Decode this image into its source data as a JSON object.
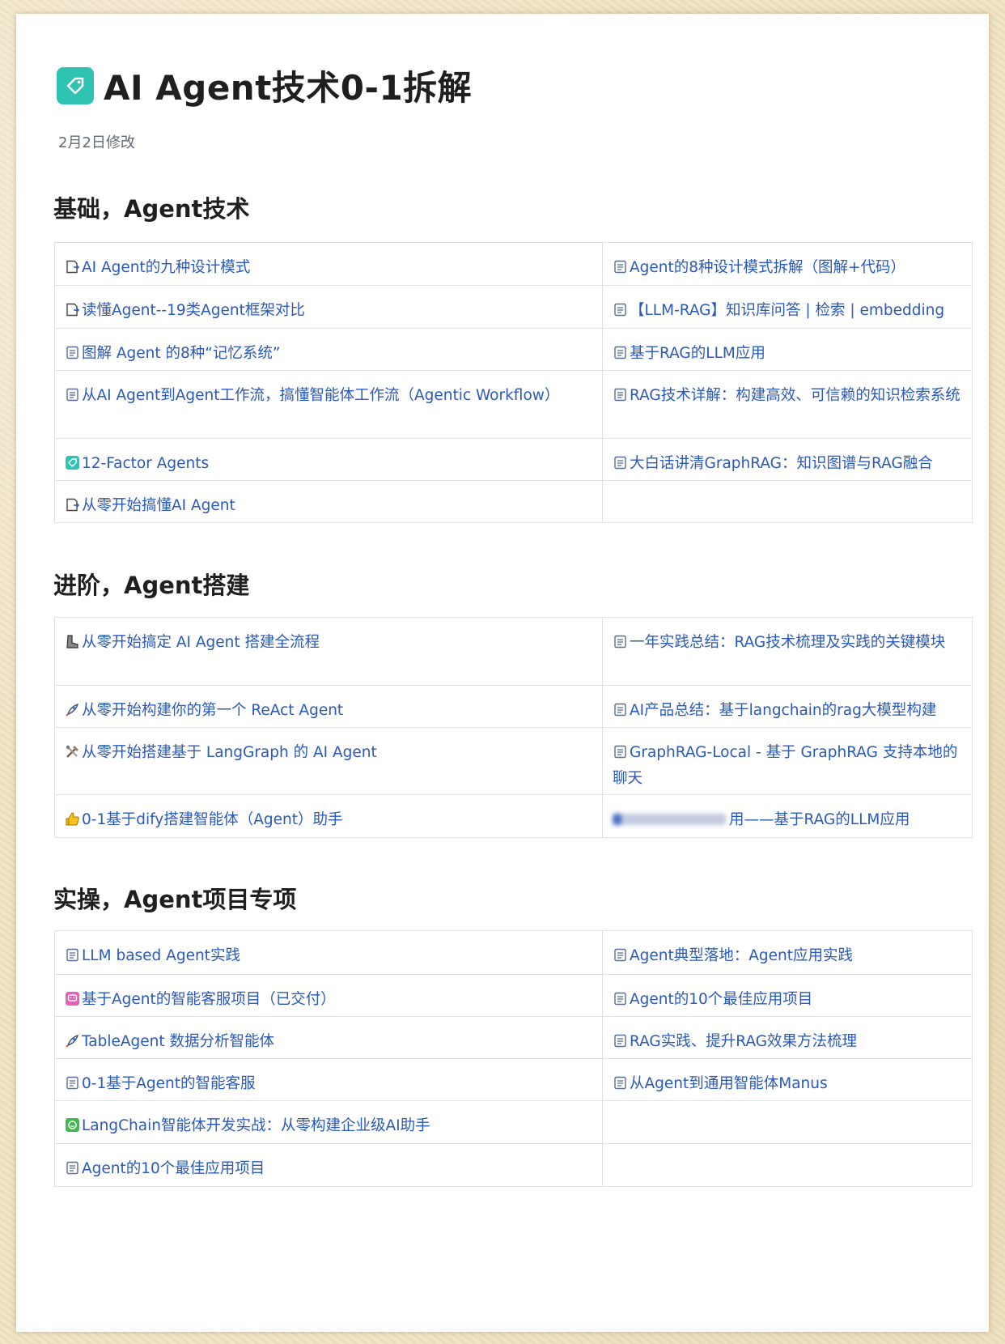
{
  "page": {
    "title": "AI Agent技术0-1拆解",
    "modified": "2月2日修改",
    "title_icon": "tag-icon",
    "colors": {
      "link": "#2a59bd",
      "title_icon_bg": "#2fc3b4",
      "background": "#efe3c4"
    }
  },
  "sections": [
    {
      "heading": "基础，Agent技术",
      "rows": [
        [
          {
            "icon": "doc-arrow-icon",
            "text": "AI Agent的九种设计模式"
          },
          {
            "icon": "doc-icon",
            "text": "Agent的8种设计模式拆解（图解+代码）"
          }
        ],
        [
          {
            "icon": "doc-arrow-icon",
            "text": "读懂Agent--19类Agent框架对比"
          },
          {
            "icon": "doc-icon",
            "text": "【LLM-RAG】知识库问答 | 检索 | embedding"
          }
        ],
        [
          {
            "icon": "doc-icon",
            "text": "图解 Agent 的8种“记忆系统”"
          },
          {
            "icon": "doc-icon",
            "text": "基于RAG的LLM应用"
          }
        ],
        [
          {
            "icon": "doc-icon",
            "text": "从AI Agent到Agent工作流，搞懂智能体工作流（Agentic Workflow）"
          },
          {
            "icon": "doc-icon",
            "text": "RAG技术详解：构建高效、可信赖的知识检索系统"
          }
        ],
        [
          {
            "icon": "teal-tag-icon",
            "text": "12-Factor Agents"
          },
          {
            "icon": "doc-icon",
            "text": "大白话讲清GraphRAG：知识图谱与RAG融合"
          }
        ],
        [
          {
            "icon": "doc-arrow-icon",
            "text": "从零开始搞懂AI Agent"
          },
          null
        ]
      ]
    },
    {
      "heading": "进阶，Agent搭建",
      "rows": [
        [
          {
            "icon": "boot-icon",
            "text": "从零开始搞定 AI Agent 搭建全流程"
          },
          {
            "icon": "doc-icon",
            "text": "一年实践总结：RAG技术梳理及实践的关键模块"
          }
        ],
        [
          {
            "icon": "rocket-icon",
            "text": "从零开始构建你的第一个 ReAct Agent"
          },
          {
            "icon": "doc-icon",
            "text": "AI产品总结：基于langchain的rag大模型构建"
          }
        ],
        [
          {
            "icon": "tools-icon",
            "text": "从零开始搭建基于 LangGraph 的 AI Agent"
          },
          {
            "icon": "doc-icon",
            "text": "GraphRAG-Local - 基于 GraphRAG 支持本地的聊天"
          }
        ],
        [
          {
            "icon": "thumbs-up-icon",
            "text": "0-1基于dify搭建智能体（Agent）助手"
          },
          {
            "icon": "blurred-icon",
            "text": "用——基于RAG的LLM应用",
            "blurred": true
          }
        ]
      ]
    },
    {
      "heading": "实操，Agent项目专项",
      "rows": [
        [
          {
            "icon": "doc-icon",
            "text": "LLM based Agent实践"
          },
          {
            "icon": "doc-icon",
            "text": "Agent典型落地：Agent应用实践"
          }
        ],
        [
          {
            "icon": "pink-chat-icon",
            "text": "基于Agent的智能客服项目（已交付）"
          },
          {
            "icon": "doc-icon",
            "text": "Agent的10个最佳应用项目"
          }
        ],
        [
          {
            "icon": "rocket-icon",
            "text": "TableAgent 数据分析智能体"
          },
          {
            "icon": "doc-icon",
            "text": "RAG实践、提升RAG效果方法梳理"
          }
        ],
        [
          {
            "icon": "doc-icon",
            "text": "0-1基于Agent的智能客服"
          },
          {
            "icon": "doc-icon",
            "text": "从Agent到通用智能体Manus"
          }
        ],
        [
          {
            "icon": "green-chat-icon",
            "text": "LangChain智能体开发实战：从零构建企业级AI助手"
          },
          null
        ],
        [
          {
            "icon": "doc-icon",
            "text": "Agent的10个最佳应用项目"
          },
          null
        ]
      ]
    }
  ]
}
